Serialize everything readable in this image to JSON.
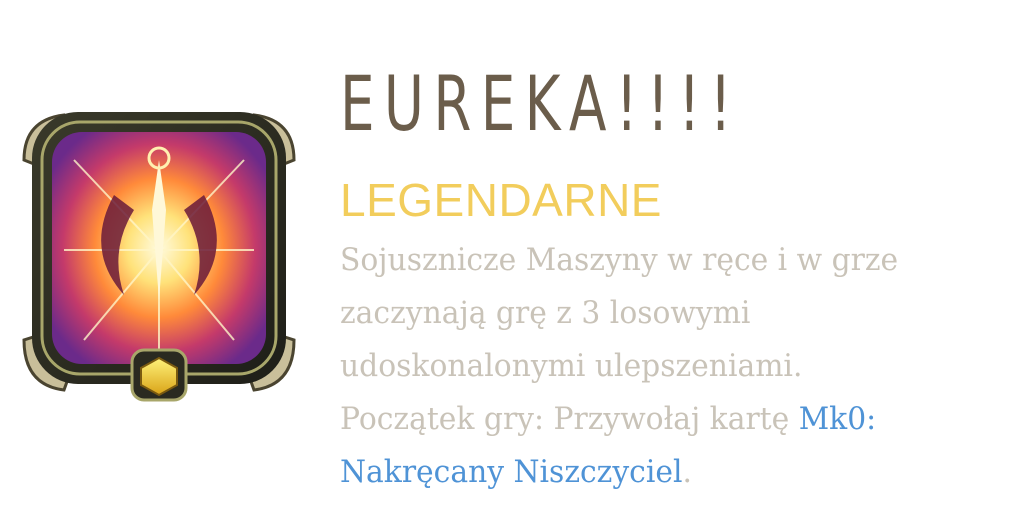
{
  "card": {
    "title": "EUREKA!!!!",
    "rarity": "LEGENDARNE",
    "description": {
      "line1": "Sojusznicze Maszyny w ręce i w grze",
      "line2": "zaczynają grę z 3 losowymi",
      "line3": "udoskonalonymi ulepszeniami.",
      "line4_prefix": "Początek gry: Przywołaj kartę ",
      "link_part1": "Mk0:",
      "link_part2": "Nakręcany Niszczyciel",
      "suffix": "."
    },
    "colors": {
      "title": "#6b5d4b",
      "rarity": "#f2cd5c",
      "description": "#c9c3b8",
      "link": "#4f93d6"
    },
    "icon": "engineer-rebel-burst-icon"
  }
}
